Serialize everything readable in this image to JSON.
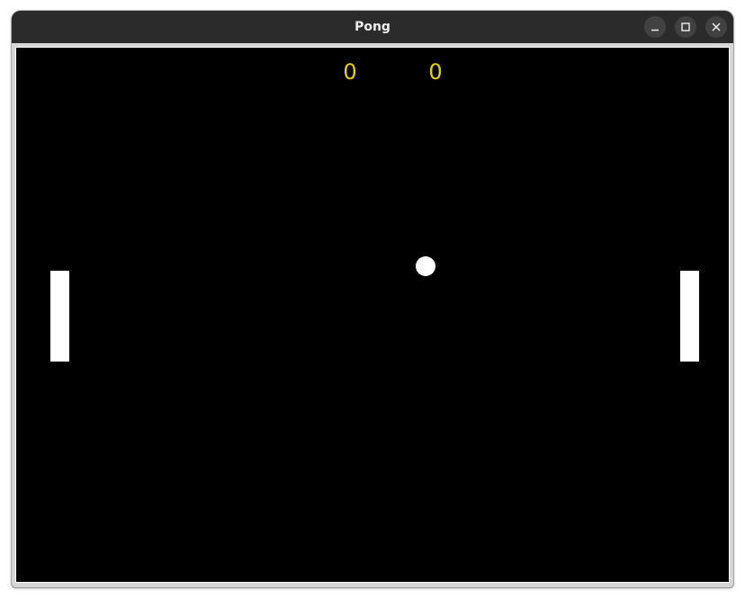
{
  "window": {
    "title": "Pong",
    "controls": {
      "minimize_icon": "minimize-icon",
      "maximize_icon": "maximize-icon",
      "close_icon": "close-icon"
    }
  },
  "game": {
    "score_left": "0",
    "score_right": "0",
    "colors": {
      "background": "#000000",
      "score": "#e6d200",
      "paddle": "#ffffff",
      "ball": "#ffffff"
    }
  }
}
